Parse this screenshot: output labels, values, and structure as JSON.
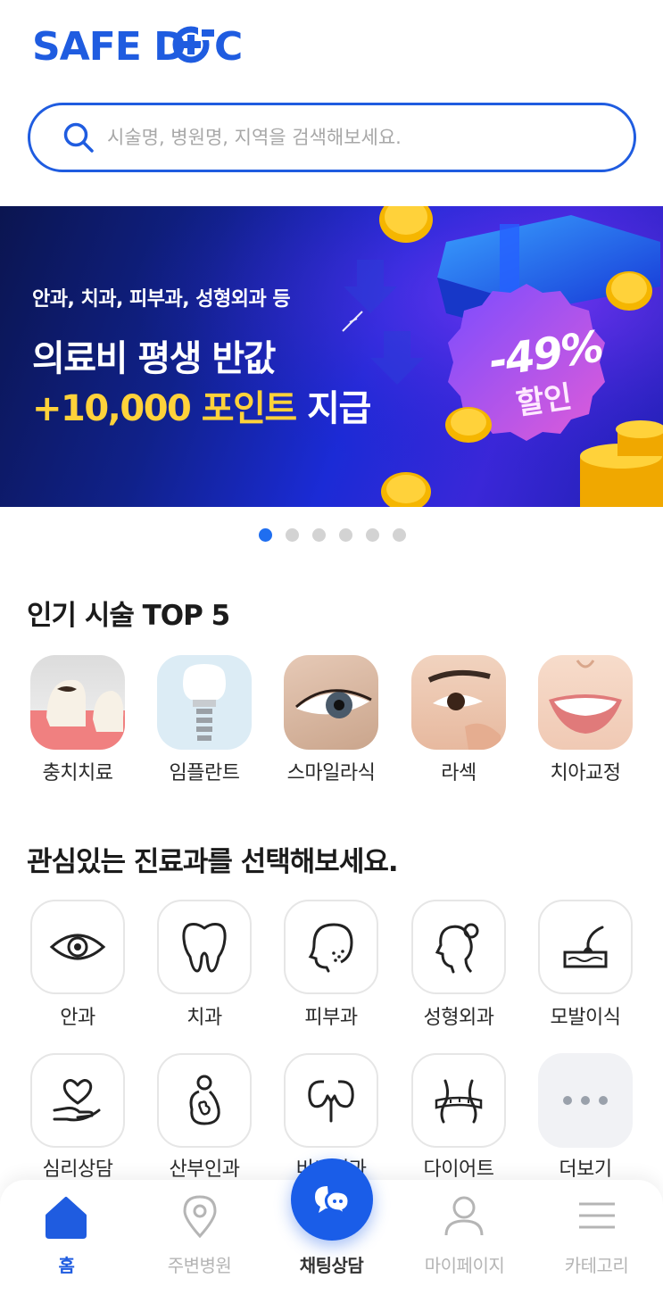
{
  "app": {
    "logo_text": "SAFE DOC",
    "brand_color": "#1f5ce0",
    "accent_color": "#1f6ef0"
  },
  "search": {
    "placeholder": "시술명, 병원명, 지역을 검색해보세요.",
    "value": ""
  },
  "banner": {
    "subtitle": "안과, 치과, 피부과, 성형외과 등",
    "headline": "의료비 평생 반값",
    "highlight": "+10,000 포인트",
    "highlight_suffix": "지급",
    "discount": "-49%",
    "discount_label": "할인",
    "current_slide": 1,
    "total_slides": 6
  },
  "popular": {
    "title": "인기 시술 TOP 5",
    "items": [
      {
        "label": "충치치료",
        "icon": "cavity-tooth-image"
      },
      {
        "label": "임플란트",
        "icon": "implant-image"
      },
      {
        "label": "스마일라식",
        "icon": "eye-closeup-image"
      },
      {
        "label": "라섹",
        "icon": "eye-face-image"
      },
      {
        "label": "치아교정",
        "icon": "smile-image"
      }
    ]
  },
  "departments": {
    "title": "관심있는 진료과를 선택해보세요.",
    "items": [
      {
        "label": "안과",
        "icon": "eye-icon"
      },
      {
        "label": "치과",
        "icon": "tooth-icon"
      },
      {
        "label": "피부과",
        "icon": "face-skin-icon"
      },
      {
        "label": "성형외과",
        "icon": "face-profile-icon"
      },
      {
        "label": "모발이식",
        "icon": "hair-follicle-icon"
      },
      {
        "label": "심리상담",
        "icon": "heart-hand-icon"
      },
      {
        "label": "산부인과",
        "icon": "pregnant-icon"
      },
      {
        "label": "비뇨기과",
        "icon": "kidney-icon"
      },
      {
        "label": "다이어트",
        "icon": "waist-measure-icon"
      },
      {
        "label": "더보기",
        "icon": "more-dots-icon"
      }
    ]
  },
  "tabbar": {
    "items": [
      {
        "label": "홈",
        "icon": "home-icon",
        "active": true
      },
      {
        "label": "주변병원",
        "icon": "location-pin-icon",
        "active": false
      },
      {
        "label": "채팅상담",
        "icon": "chat-bubbles-icon",
        "active": false
      },
      {
        "label": "마이페이지",
        "icon": "person-icon",
        "active": false
      },
      {
        "label": "카테고리",
        "icon": "menu-lines-icon",
        "active": false
      }
    ]
  }
}
